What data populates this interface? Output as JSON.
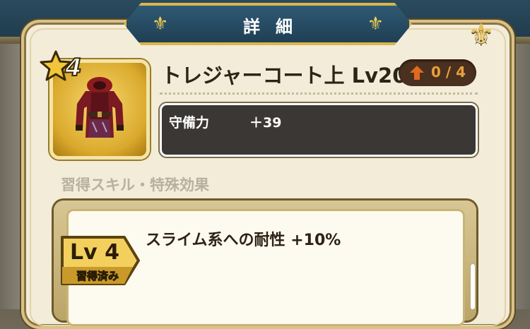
{
  "header": {
    "title": "詳細"
  },
  "item": {
    "rarity_stars": "4",
    "name": "トレジャーコート上 Lv20",
    "upgrade": "0 / 4",
    "icon": "treasure-coat-icon"
  },
  "stats": [
    {
      "label": "守備力",
      "value": "＋39"
    }
  ],
  "skills": {
    "section_title": "習得スキル・特殊効果",
    "items": [
      {
        "level": "Lv 4",
        "status": "習得済み",
        "text": "スライム系への耐性 +10%"
      }
    ]
  },
  "colors": {
    "header_bg": "#2f5a74",
    "gold_border": "#d9b64d",
    "parchment": "#f3ecd9",
    "upgrade_text": "#e9a13b",
    "stats_bg": "#3a3734"
  }
}
